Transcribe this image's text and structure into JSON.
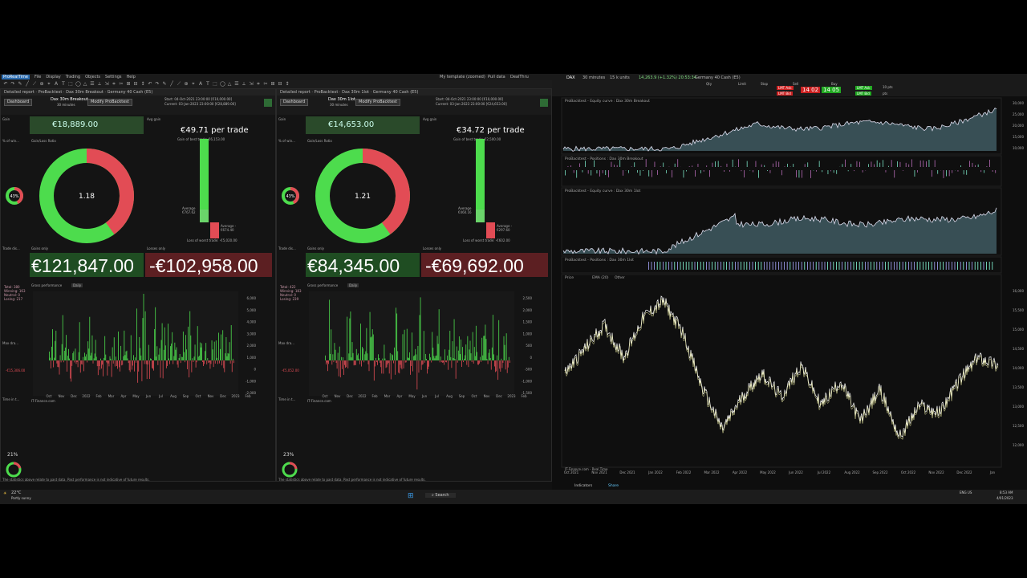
{
  "app": {
    "logo": "ProRealTime",
    "menu": [
      "File",
      "Display",
      "Trading",
      "Objects",
      "Settings",
      "Help"
    ],
    "right_menu": [
      "My template (zoomed)",
      "Pull data",
      "DealThru"
    ]
  },
  "panels": [
    {
      "tab": "Detailed report",
      "tab2": "ProBacktest",
      "instrument": "Dax 30m Breakout",
      "market": "Germany 40 Cash (E5)",
      "dashboard": "Dashboard",
      "strategy_name": "Dax 30m Breakout",
      "timeframe": "30 minutes",
      "modify": "Modify ProBacktest",
      "start": "Start: 04-Oct-2021 23:00:00 [€10,000.00]",
      "current": "Current: 03-Jan-2023 23:00:00 [€28,889.00]",
      "gain_label": "Gain",
      "gain": "€18,889.00",
      "avg_gain_label": "Avg gain",
      "avg_gain": "€49.71 per trade",
      "best_trade": "Gain of best trade: €6,153.00",
      "worst_trade": "Loss of worst trade: -€5,020.00",
      "average_pos": "Average €767.62",
      "average_neg": "Average -€674.40",
      "pct_win_label": "% of win...",
      "pct_win": "43%",
      "ratio_label": "Gain/Loss Ratio",
      "ratio": "1.18",
      "trade_dist": "Trade dis...",
      "gains_only": "Gains only",
      "gains_total": "€121,847.00",
      "losses_only": "Losses only",
      "losses_total": "-€102,958.00",
      "total_info": "Total: 380 Winning: 163 Neutral: 0 Losing: 217",
      "gross_perf": "Gross performance",
      "daily": "Daily",
      "max_dd": "Max dra...",
      "max_dd_val": "-€15,306.00",
      "time_in": "Time in t...",
      "time_pct": "21%",
      "x_ticks": [
        "Oct",
        "Nov",
        "Dec",
        "2022",
        "Feb",
        "Mar",
        "Apr",
        "May",
        "Jun",
        "Jul",
        "Aug",
        "Sep",
        "Oct",
        "Nov",
        "Dec",
        "2023",
        "Feb"
      ],
      "y_ticks": [
        "6,000",
        "5,000",
        "4,000",
        "3,000",
        "2,000",
        "1,000",
        "0",
        "-1,000",
        "-2,000"
      ],
      "source": "IT-Finance.com",
      "disclaimer": "The statistics above relate to past data. Past performance is not indicative of future results."
    },
    {
      "tab": "Detailed report",
      "tab2": "ProBacktest",
      "instrument": "Dax 30m 1lot",
      "market": "Germany 40 Cash (E5)",
      "dashboard": "Dashboard",
      "strategy_name": "Dax 30m 1lot",
      "timeframe": "30 minutes",
      "modify": "Modify ProBacktest",
      "start": "Start: 04-Oct-2021 23:00:00 [€10,000.00]",
      "current": "Current: 03-Jan-2023 23:00:00 [€24,653.00]",
      "gain_label": "Gain",
      "gain": "€14,653.00",
      "avg_gain_label": "Avg gain",
      "avg_gain": "€34.72 per trade",
      "best_trade": "Gain of best trade: €2,500.00",
      "worst_trade": "Loss of worst trade: -€602.00",
      "average_pos": "Average €460.16",
      "average_neg": "Average -€297.60",
      "pct_win_label": "% of win...",
      "pct_win": "43%",
      "ratio_label": "Gain/Loss Ratio",
      "ratio": "1.21",
      "trade_dist": "Trade dis...",
      "gains_only": "Gains only",
      "gains_total": "€84,345.00",
      "losses_only": "Losses only",
      "losses_total": "-€69,692.00",
      "total_info": "Total: 422 Winning: 183 Neutral: 0 Losing: 239",
      "gross_perf": "Gross performance",
      "daily": "Daily",
      "max_dd": "Max dra...",
      "max_dd_val": "-€5,052.00",
      "time_in": "Time in t...",
      "time_pct": "23%",
      "x_ticks": [
        "Oct",
        "Nov",
        "Dec",
        "2022",
        "Feb",
        "Mar",
        "Apr",
        "May",
        "Jun",
        "Jul",
        "Aug",
        "Sep",
        "Oct",
        "Nov",
        "Dec",
        "2023",
        "Feb"
      ],
      "y_ticks": [
        "2,500",
        "2,000",
        "1,500",
        "1,000",
        "500",
        "0",
        "-500",
        "-1,000",
        "-1,500"
      ],
      "source": "IT-Finance.com",
      "disclaimer": "The statistics above relate to past data. Past performance is not indicative of future results."
    }
  ],
  "right": {
    "symbol": "DAX",
    "timeframe": "30 minutes",
    "units": "15 k units",
    "quote": "14,263.9 (+1.32%) 20:53:34",
    "market": "Germany 40 Cash (E5)",
    "qty_label": "Qty",
    "limit_label": "Limit",
    "stop_label": "Stop",
    "sell_label": "Sell",
    "buy_label": "Buy",
    "lmt_ask": "LMT Ask",
    "lmt_bid": "LMT Bid",
    "sell_price": "14 02",
    "buy_price": "14 05",
    "pts1": "10 pts",
    "pts2": "pts",
    "pane1": "ProBacktest - Equity curve : Dax 30m Breakout",
    "pane2": "ProBacktest - Positions : Dax 30m Breakout",
    "pane3": "ProBacktest - Equity curve : Dax 30m 1lot",
    "pane4": "ProBacktest - Positions : Dax 30m 1lot",
    "price_pane": "Price",
    "ema_label": "EMA (20)",
    "other": "Other",
    "y_ticks_price": [
      "16,000",
      "15,500",
      "15,000",
      "14,500",
      "14,000",
      "13,500",
      "13,000",
      "12,500",
      "12,000"
    ],
    "y_ticks_eq": [
      "30,000",
      "25,000",
      "20,000",
      "15,000",
      "10,000"
    ],
    "x_ticks": [
      "Oct 2021",
      "Nov 2021",
      "Dec 2021",
      "Jan 2022",
      "Feb 2022",
      "Mar 2022",
      "Apr 2022",
      "May 2022",
      "Jun 2022",
      "Jul 2022",
      "Aug 2022",
      "Sep 2022",
      "Oct 2022",
      "Nov 2022",
      "Dec 2022",
      "Jan"
    ],
    "source": "IT-Finance.com - Real Time",
    "indicators": "Indicators",
    "share": "Share"
  },
  "taskbar": {
    "weather_temp": "22°C",
    "weather": "Partly sunny",
    "search": "Search",
    "lang": "ENG US",
    "time": "8:53 AM",
    "date": "4/01/2023"
  },
  "colors": {
    "win": "#4ddc4d",
    "loss": "#e24c55",
    "equity_fill": "#3f5a61"
  }
}
